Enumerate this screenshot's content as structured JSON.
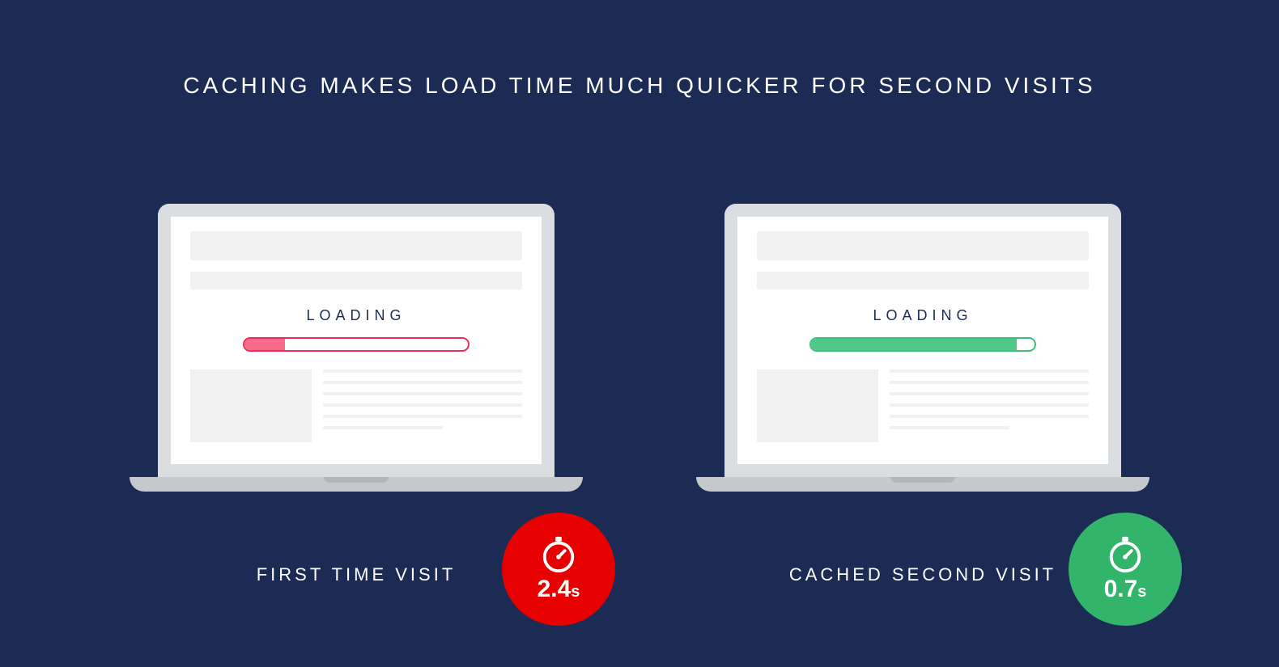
{
  "heading": "CACHING MAKES LOAD TIME MUCH QUICKER FOR SECOND VISITS",
  "panels": {
    "first": {
      "loading_label": "LOADING",
      "progress_percent": 18,
      "progress_color": "#ee2c57",
      "progress_fill_color": "#f76a8a",
      "badge_color": "#e60000",
      "time_value": "2.4",
      "time_unit": "s",
      "caption": "FIRST TIME VISIT"
    },
    "cached": {
      "loading_label": "LOADING",
      "progress_percent": 92,
      "progress_color": "#3fbf7a",
      "progress_fill_color": "#4fc887",
      "badge_color": "#32b56b",
      "time_value": "0.7",
      "time_unit": "s",
      "caption": "CACHED SECOND VISIT"
    }
  }
}
